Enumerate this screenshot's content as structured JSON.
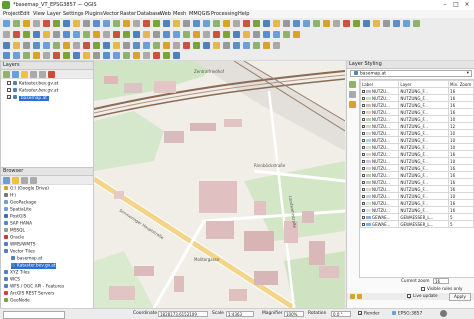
{
  "window": {
    "title": "*basemap_VT_EPSG3857 — QGIS"
  },
  "menu": [
    "Project",
    "Edit",
    "View",
    "Layer",
    "Settings",
    "Plugins",
    "Vector",
    "Raster",
    "Database",
    "Web",
    "Mesh",
    "MMQGIS",
    "Processing",
    "Help"
  ],
  "layers_panel": {
    "title": "Layers",
    "layers": [
      {
        "name": "Kataster.bev.gv.at",
        "checked": false,
        "selected": false
      },
      {
        "name": "Kataster.bev.gv.at",
        "checked": false,
        "selected": false
      },
      {
        "name": "basemap.at",
        "checked": true,
        "selected": true
      }
    ]
  },
  "browser_panel": {
    "title": "Browser",
    "items": [
      "G:\\ (Google Drive)",
      "H:\\",
      "GeoPackage",
      "SpatiaLite",
      "PostGIS",
      "SAP HANA",
      "MSSQL",
      "Oracle",
      "WMS/WMTS",
      "Vector Tiles",
      "basemap.at",
      "Kataster.bev.gv.at",
      "XYZ Tiles",
      "WCS",
      "WFS / OGC API - Features",
      "ArcGIS REST Servers",
      "GeoNode"
    ],
    "item_colors": [
      "#d9a32b",
      "#777777",
      "#6a9fd8",
      "#6a9fd8",
      "#3f6ea8",
      "#4b8ad6",
      "#999999",
      "#c23b22",
      "#4f81bd",
      "#4f81bd",
      "#4f81bd",
      "#4f81bd",
      "#4f81bd",
      "#4f81bd",
      "#4f81bd",
      "#c43",
      "#7aa33c"
    ]
  },
  "map": {
    "street_labels": [
      "Zentralfriedhof",
      "Simmeringer Hauptstraße",
      "Rinnböckstraße",
      "Landwehrstraße",
      "Molitorgasse"
    ]
  },
  "layer_styling": {
    "title": "Layer Styling",
    "layer_select": "basemap.at",
    "columns": [
      "Label",
      "Layer",
      "Min. Zoom"
    ],
    "rows": [
      {
        "label": "NUTZU...",
        "layer": "NUTZUNG_F...",
        "zoom": "16",
        "color": "#c6b6d4"
      },
      {
        "label": "NUTZU...",
        "layer": "NUTZUNG_F...",
        "zoom": "16",
        "color": "#c8dfb8"
      },
      {
        "label": "NUTZU...",
        "layer": "NUTZUNG_F...",
        "zoom": "16",
        "color": "#d6c0ae"
      },
      {
        "label": "NUTZU...",
        "layer": "NUTZUNG_F...",
        "zoom": "16",
        "color": "#e9c9c9"
      },
      {
        "label": "NUTZU...",
        "layer": "NUTZUNG_F...",
        "zoom": "10",
        "color": "#b8d7a8"
      },
      {
        "label": "NUTZU...",
        "layer": "NUTZUNG_F...",
        "zoom": "12",
        "color": "#c9e0c0"
      },
      {
        "label": "NUTZU...",
        "layer": "NUTZUNG_F...",
        "zoom": "10",
        "color": "#d7d7d7"
      },
      {
        "label": "NUTZU...",
        "layer": "NUTZUNG_F...",
        "zoom": "10",
        "color": "#a6d5f0"
      },
      {
        "label": "NUTZU...",
        "layer": "NUTZUNG_F...",
        "zoom": "10",
        "color": "#cfe3c2"
      },
      {
        "label": "NUTZU...",
        "layer": "NUTZUNG_F...",
        "zoom": "16",
        "color": "#e3cfcf"
      },
      {
        "label": "NUTZU...",
        "layer": "NUTZUNG_F...",
        "zoom": "10",
        "color": "#d0c3dc"
      },
      {
        "label": "NUTZU...",
        "layer": "NUTZUNG_F...",
        "zoom": "16",
        "color": "#d2d2d2"
      },
      {
        "label": "NUTZU...",
        "layer": "NUTZUNG_F...",
        "zoom": "16",
        "color": "#bcd3a3"
      },
      {
        "label": "NUTZU...",
        "layer": "NUTZUNG_F...",
        "zoom": "16",
        "color": "#c4c4c4"
      },
      {
        "label": "NUTZU...",
        "layer": "NUTZUNG_F...",
        "zoom": "16",
        "color": "#e6d3c3"
      },
      {
        "label": "NUTZU...",
        "layer": "NUTZUNG_F...",
        "zoom": "10",
        "color": "#b5d2ef"
      },
      {
        "label": "NUTZU...",
        "layer": "NUTZUNG_F...",
        "zoom": "16",
        "color": "#d9e8cf"
      },
      {
        "label": "NUTZU...",
        "layer": "NUTZUNG_F...",
        "zoom": "16",
        "color": "#e1e1e1"
      },
      {
        "label": "GEWAE...",
        "layer": "GEWAESSER_L...",
        "zoom": "5",
        "color": "#7fb2e5"
      },
      {
        "label": "GEWAE...",
        "layer": "GEWAESSER_L...",
        "zoom": "5",
        "color": "#7fb2e5"
      }
    ],
    "current_zoom_label": "Current zoom",
    "current_zoom": "16",
    "visible_rules_only": "Visible rules only",
    "live_update": "Live update",
    "apply": "Apply"
  },
  "status": {
    "coordinate_label": "Coordinate",
    "coordinate": "1828173,6152109",
    "scale_label": "Scale",
    "scale": "1:4363",
    "magnifier_label": "Magnifier",
    "magnifier": "100%",
    "rotation_label": "Rotation",
    "rotation": "0.0 °",
    "render": "Render",
    "crs": "EPSG:3857"
  }
}
